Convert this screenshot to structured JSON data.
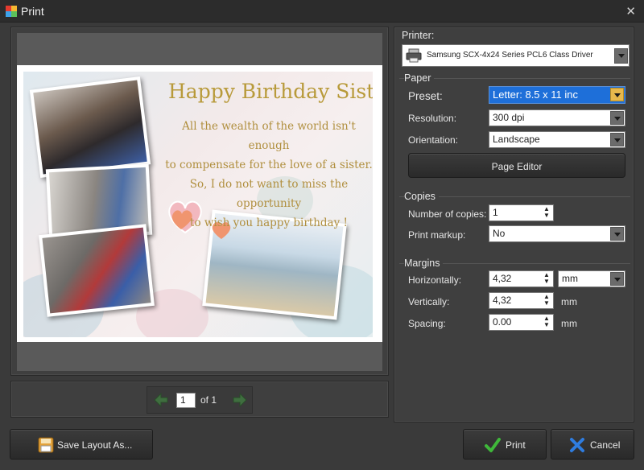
{
  "window": {
    "title": "Print",
    "close_icon": "close-icon"
  },
  "preview": {
    "card_title": "Happy Birthday Sister !",
    "card_lines": [
      "All the wealth of the world isn't enough",
      "to compensate for the love of a sister.",
      "So, I do not want to miss the opportunity",
      "to wish you happy birthday !"
    ],
    "pager": {
      "current_page": "1",
      "of_label": "of 1",
      "prev_icon": "arrow-left-icon",
      "next_icon": "arrow-right-icon"
    }
  },
  "printer": {
    "section_label": "Printer:",
    "selected": "Samsung SCX-4x24 Series PCL6 Class Driver",
    "icon": "printer-icon"
  },
  "paper": {
    "section_label": "Paper",
    "preset_label": "Preset:",
    "preset_value": "Letter: 8.5 x 11 inc",
    "resolution_label": "Resolution:",
    "resolution_value": "300 dpi",
    "orientation_label": "Orientation:",
    "orientation_value": "Landscape",
    "page_editor_label": "Page Editor"
  },
  "copies": {
    "section_label": "Copies",
    "count_label": "Number of copies:",
    "count_value": "1",
    "markup_label": "Print markup:",
    "markup_value": "No"
  },
  "margins": {
    "section_label": "Margins",
    "horizontal_label": "Horizontally:",
    "horizontal_value": "4,32",
    "unit_value": "mm",
    "vertical_label": "Vertically:",
    "vertical_value": "4,32",
    "vertical_unit": "mm",
    "spacing_label": "Spacing:",
    "spacing_value": "0.00",
    "spacing_unit": "mm"
  },
  "buttons": {
    "save_layout": "Save Layout As...",
    "print": "Print",
    "cancel": "Cancel"
  },
  "colors": {
    "preset_highlight": "#1e6fd9",
    "card_text": "#b08f3e",
    "print_check": "#3fb83a",
    "cancel_x": "#2f7de0"
  }
}
